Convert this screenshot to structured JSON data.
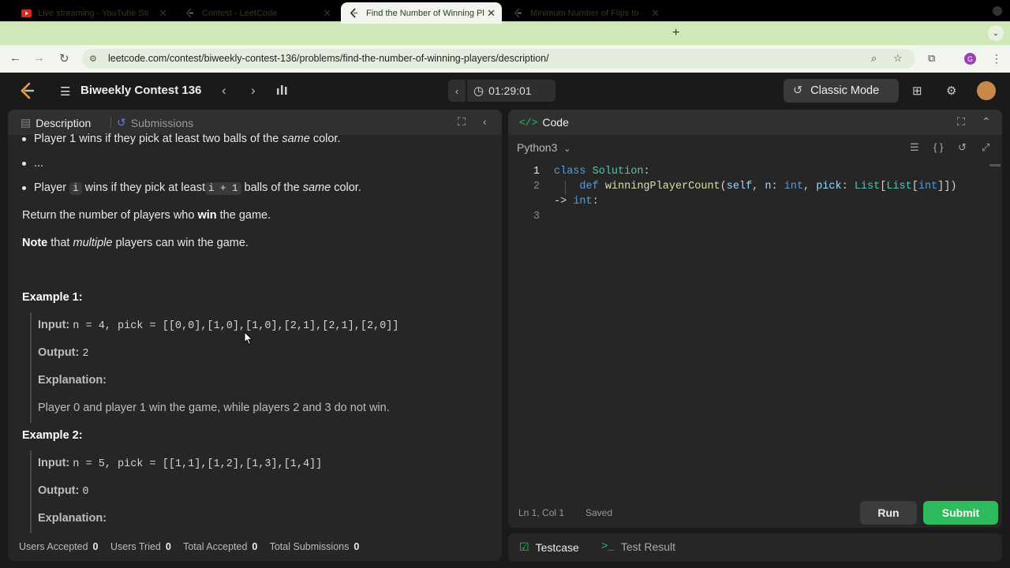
{
  "browser": {
    "tabs": [
      {
        "label": "Live streaming - YouTube Studio",
        "icon": "youtube-icon"
      },
      {
        "label": "Contest - LeetCode",
        "icon": "leetcode-icon"
      },
      {
        "label": "Find the Number of Winning Players",
        "icon": "leetcode-icon"
      },
      {
        "label": "Minimum Number of Flips to Make",
        "icon": "leetcode-icon"
      }
    ],
    "url": "leetcode.com/contest/biweekly-contest-136/problems/find-the-number-of-winning-players/description/",
    "profile_initial": "G"
  },
  "app": {
    "contest_title": "Biweekly Contest 136",
    "timer": "01:29:01",
    "mode_label": "Classic Mode"
  },
  "left_panel": {
    "tab_description": "Description",
    "tab_submissions": "Submissions",
    "content": {
      "b1_pre": "Player 1 wins if they pick at least two balls of the ",
      "b1_em": "same",
      "b1_post": " color.",
      "b2": "...",
      "b3_pre": "Player ",
      "b3_code1": "i",
      "b3_mid": " wins if they pick at least",
      "b3_code2": "i + 1",
      "b3_mid2": " balls of the ",
      "b3_em": "same",
      "b3_post": " color.",
      "p1_pre": "Return the number of players who ",
      "p1_bold": "win",
      "p1_post": " the game.",
      "p2_bold": "Note",
      "p2_mid": " that ",
      "p2_em": "multiple",
      "p2_post": " players can win the game.",
      "ex1_title": "Example 1:",
      "ex1_input_label": "Input:",
      "ex1_input": "n = 4, pick = [[0,0],[1,0],[1,0],[2,1],[2,1],[2,0]]",
      "ex1_output_label": "Output:",
      "ex1_output": "2",
      "ex1_expl_label": "Explanation:",
      "ex1_expl": "Player 0 and player 1 win the game, while players 2 and 3 do not win.",
      "ex2_title": "Example 2:",
      "ex2_input_label": "Input:",
      "ex2_input": "n = 5, pick = [[1,1],[1,2],[1,3],[1,4]]",
      "ex2_output_label": "Output:",
      "ex2_output": "0",
      "ex2_expl_label": "Explanation:"
    },
    "stats": {
      "users_accepted_label": "Users Accepted",
      "users_accepted": "0",
      "users_tried_label": "Users Tried",
      "users_tried": "0",
      "total_accepted_label": "Total Accepted",
      "total_accepted": "0",
      "total_submissions_label": "Total Submissions",
      "total_submissions": "0"
    }
  },
  "right_panel": {
    "title": "Code",
    "language": "Python3",
    "line_numbers": [
      "1",
      "2",
      "3"
    ],
    "status_position": "Ln 1, Col 1",
    "status_saved": "Saved",
    "run_label": "Run",
    "submit_label": "Submit"
  },
  "bottom_panel": {
    "testcase_label": "Testcase",
    "testresult_label": "Test Result"
  },
  "colors": {
    "accent_green": "#2cbb5d",
    "tab_bar": "#cfe8b8"
  }
}
